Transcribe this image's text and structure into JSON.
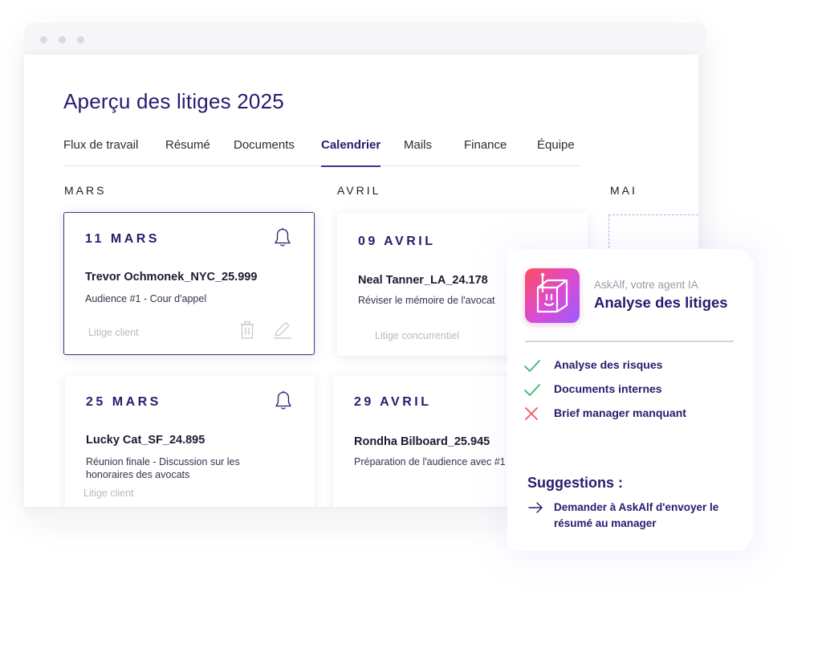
{
  "page": {
    "title": "Aperçu des litiges 2025"
  },
  "tabs": [
    {
      "label": "Flux de travail"
    },
    {
      "label": "Résumé"
    },
    {
      "label": "Documents"
    },
    {
      "label": "Calendrier",
      "active": true
    },
    {
      "label": "Mails"
    },
    {
      "label": "Finance"
    },
    {
      "label": "Équipe"
    }
  ],
  "months": [
    "MARS",
    "AVRIL",
    "MAI"
  ],
  "cards": [
    {
      "date": "11 MARS",
      "client": "Trevor Ochmonek_NYC_25.999",
      "desc": "Audience #1 - Cour d'appel",
      "tag": "Litige client",
      "icons": [
        "bell-icon",
        "trash-icon",
        "edit-icon"
      ]
    },
    {
      "date": "09 AVRIL",
      "client": "Neal Tanner_LA_24.178",
      "desc": "Réviser le mémoire de l'avocat",
      "tag": "Litige concurrentiel"
    },
    {
      "date": "25 MARS",
      "client": "Lucky Cat_SF_24.895",
      "desc": "Réunion finale - Discussion sur les honoraires des avocats",
      "tag": "Litige client",
      "icons": [
        "bell-icon"
      ]
    },
    {
      "date": "29 AVRIL",
      "client": "Rondha Bilboard_25.945",
      "desc": "Préparation de l'audience avec #1",
      "tag": ""
    }
  ],
  "ai_panel": {
    "subtitle": "AskAlf, votre agent IA",
    "title": "Analyse des litiges",
    "checks": [
      {
        "label": "Analyse des risques",
        "status": "ok"
      },
      {
        "label": "Documents internes",
        "status": "ok"
      },
      {
        "label": "Brief manager manquant",
        "status": "missing"
      }
    ],
    "suggestions_title": "Suggestions :",
    "suggestions": [
      "Demander à AskAlf d'envoyer le résumé au manager"
    ]
  },
  "colors": {
    "brand": "#2a1a6e",
    "accent": "#4b2a8e",
    "check_ok": "#3dba6f",
    "check_missing": "#f0576a",
    "tag_grey": "#b8b8c4"
  }
}
